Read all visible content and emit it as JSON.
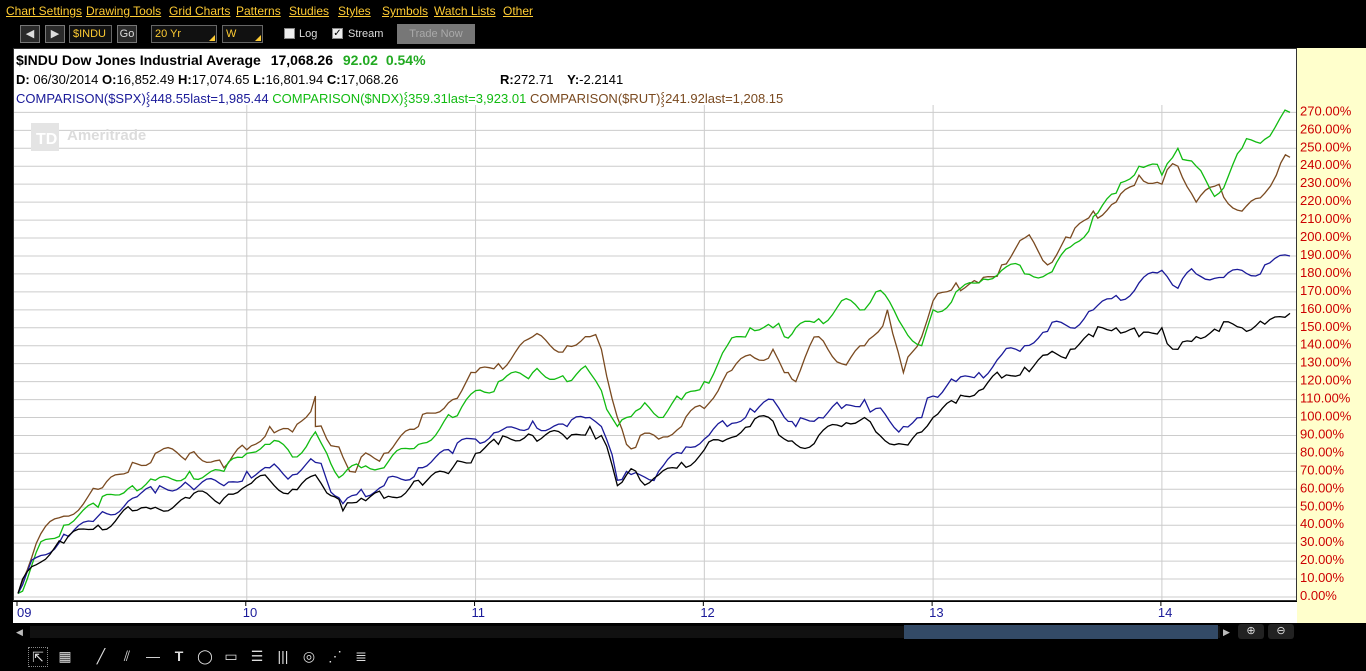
{
  "menu": [
    "Chart Settings",
    "Drawing Tools",
    "Grid Charts",
    "Patterns",
    "Studies",
    "Styles",
    "Symbols",
    "Watch Lists",
    "Other"
  ],
  "toolbar": {
    "symbol": "$INDU",
    "go_label": "Go",
    "period": "20 Yr",
    "interval": "W",
    "log_label": "Log",
    "log_checked": false,
    "stream_label": "Stream",
    "stream_checked": true,
    "check_mark": "✓",
    "trade_label": "Trade Now"
  },
  "header": {
    "symbol_desc": "$INDU Dow Jones Industrial Average",
    "last": "17,068.26",
    "change": "92.02",
    "change_pct": "0.54%",
    "d_label": "D:",
    "date": "06/30/2014",
    "o_label": "O:",
    "open": "16,852.49",
    "h_label": "H:",
    "high": "17,074.65",
    "l_label": "L:",
    "low": "16,801.94",
    "c_label": "C:",
    "close": "17,068.26",
    "r_label": "R:",
    "range": "272.71",
    "y_label": "Y:",
    "y_value": "-2.2141",
    "comparisons": [
      {
        "text": "COMPARISON($SPX)",
        "stats": "448.55last=1,985.44",
        "color": "#1a1a99"
      },
      {
        "text": "COMPARISON($NDX)",
        "stats": "359.31last=3,923.01",
        "color": "#11bb11"
      },
      {
        "text": "COMPARISON($RUT)",
        "stats": "241.92last=1,208.15",
        "color": "#7a4a20"
      }
    ]
  },
  "watermark": "Ameritrade",
  "watermark_logo": "TD",
  "colors": {
    "yaxis_text": "#cc0000",
    "xaxis_text": "#1a1a99",
    "grid": "#cccccc",
    "indu": "#000000",
    "spx": "#1a1a99",
    "ndx": "#11bb11",
    "rut": "#7a4a20"
  },
  "chart_data": {
    "type": "line",
    "title": "",
    "x_labels": [
      "09",
      "10",
      "11",
      "12",
      "13",
      "14"
    ],
    "y_ticks": [
      "0.00%",
      "10.00%",
      "20.00%",
      "30.00%",
      "40.00%",
      "50.00%",
      "60.00%",
      "70.00%",
      "80.00%",
      "90.00%",
      "100.00%",
      "110.00%",
      "120.00%",
      "130.00%",
      "140.00%",
      "150.00%",
      "160.00%",
      "170.00%",
      "180.00%",
      "190.00%",
      "200.00%",
      "210.00%",
      "220.00%",
      "230.00%",
      "240.00%",
      "250.00%",
      "260.00%",
      "270.00%"
    ],
    "ylim": [
      0,
      273
    ],
    "xlim": [
      2009.0,
      2014.56
    ],
    "grid": true,
    "series": [
      {
        "key": "rut",
        "x": [
          2009.0,
          2009.08,
          2009.2,
          2009.35,
          2009.5,
          2009.6,
          2009.75,
          2009.9,
          2010.0,
          2010.1,
          2010.2,
          2010.3,
          2010.3,
          2010.35,
          2010.42,
          2010.45,
          2010.5,
          2010.6,
          2010.75,
          2010.9,
          2011.0,
          2011.1,
          2011.25,
          2011.4,
          2011.5,
          2011.55,
          2011.62,
          2011.66,
          2011.72,
          2011.8,
          2011.9,
          2012.0,
          2012.1,
          2012.2,
          2012.3,
          2012.35,
          2012.4,
          2012.5,
          2012.6,
          2012.7,
          2012.8,
          2012.87,
          2012.95,
          2013.0,
          2013.1,
          2013.2,
          2013.3,
          2013.4,
          2013.5,
          2013.6,
          2013.7,
          2013.8,
          2013.9,
          2014.0,
          2014.07,
          2014.15,
          2014.25,
          2014.35,
          2014.45,
          2014.5,
          2014.56
        ],
        "y": [
          2,
          30,
          45,
          60,
          75,
          80,
          80,
          72,
          82,
          95,
          92,
          112,
          95,
          88,
          78,
          70,
          78,
          80,
          95,
          110,
          125,
          130,
          145,
          140,
          145,
          138,
          100,
          85,
          90,
          88,
          95,
          105,
          125,
          135,
          138,
          125,
          120,
          145,
          130,
          140,
          160,
          125,
          145,
          165,
          175,
          175,
          185,
          200,
          185,
          200,
          215,
          220,
          235,
          230,
          240,
          220,
          230,
          215,
          225,
          235,
          245
        ]
      },
      {
        "key": "ndx",
        "x": [
          2009.0,
          2009.08,
          2009.2,
          2009.35,
          2009.5,
          2009.6,
          2009.75,
          2009.9,
          2010.0,
          2010.1,
          2010.2,
          2010.3,
          2010.35,
          2010.42,
          2010.5,
          2010.6,
          2010.75,
          2010.9,
          2011.0,
          2011.1,
          2011.25,
          2011.4,
          2011.5,
          2011.55,
          2011.62,
          2011.66,
          2011.72,
          2011.8,
          2011.9,
          2012.0,
          2012.1,
          2012.2,
          2012.3,
          2012.35,
          2012.4,
          2012.5,
          2012.6,
          2012.7,
          2012.75,
          2012.87,
          2012.95,
          2013.0,
          2013.1,
          2013.2,
          2013.3,
          2013.4,
          2013.5,
          2013.6,
          2013.7,
          2013.8,
          2013.9,
          2014.0,
          2014.07,
          2014.15,
          2014.25,
          2014.35,
          2014.45,
          2014.56
        ],
        "y": [
          2,
          25,
          40,
          50,
          62,
          65,
          70,
          70,
          80,
          85,
          78,
          92,
          80,
          68,
          72,
          72,
          85,
          100,
          115,
          120,
          125,
          120,
          125,
          115,
          95,
          100,
          105,
          100,
          110,
          120,
          140,
          150,
          150,
          145,
          150,
          155,
          165,
          160,
          170,
          150,
          140,
          160,
          170,
          175,
          182,
          180,
          180,
          195,
          212,
          225,
          240,
          235,
          250,
          240,
          225,
          250,
          255,
          270
        ]
      },
      {
        "key": "spx",
        "x": [
          2009.0,
          2009.08,
          2009.2,
          2009.35,
          2009.5,
          2009.6,
          2009.75,
          2009.9,
          2010.0,
          2010.1,
          2010.2,
          2010.3,
          2010.35,
          2010.42,
          2010.5,
          2010.6,
          2010.75,
          2010.9,
          2011.0,
          2011.1,
          2011.25,
          2011.4,
          2011.5,
          2011.55,
          2011.62,
          2011.66,
          2011.72,
          2011.8,
          2011.9,
          2012.0,
          2012.1,
          2012.2,
          2012.3,
          2012.35,
          2012.4,
          2012.5,
          2012.6,
          2012.7,
          2012.75,
          2012.87,
          2012.95,
          2013.0,
          2013.1,
          2013.2,
          2013.3,
          2013.4,
          2013.5,
          2013.6,
          2013.7,
          2013.8,
          2013.9,
          2014.0,
          2014.07,
          2014.15,
          2014.25,
          2014.35,
          2014.45,
          2014.56
        ],
        "y": [
          2,
          22,
          35,
          45,
          55,
          58,
          62,
          62,
          70,
          72,
          68,
          75,
          65,
          52,
          60,
          62,
          72,
          80,
          88,
          92,
          98,
          95,
          100,
          95,
          65,
          70,
          68,
          70,
          80,
          88,
          95,
          105,
          110,
          100,
          95,
          100,
          105,
          110,
          105,
          95,
          100,
          112,
          120,
          125,
          135,
          140,
          148,
          150,
          160,
          168,
          175,
          182,
          172,
          180,
          178,
          182,
          185,
          190
        ]
      },
      {
        "key": "indu",
        "x": [
          2009.0,
          2009.08,
          2009.2,
          2009.35,
          2009.5,
          2009.6,
          2009.75,
          2009.9,
          2010.0,
          2010.1,
          2010.2,
          2010.3,
          2010.35,
          2010.42,
          2010.5,
          2010.6,
          2010.75,
          2010.9,
          2011.0,
          2011.1,
          2011.25,
          2011.4,
          2011.5,
          2011.55,
          2011.62,
          2011.66,
          2011.72,
          2011.8,
          2011.9,
          2012.0,
          2012.1,
          2012.2,
          2012.3,
          2012.35,
          2012.4,
          2012.5,
          2012.6,
          2012.7,
          2012.75,
          2012.87,
          2012.95,
          2013.0,
          2013.1,
          2013.2,
          2013.3,
          2013.4,
          2013.5,
          2013.6,
          2013.7,
          2013.8,
          2013.9,
          2014.0,
          2014.07,
          2014.15,
          2014.25,
          2014.35,
          2014.45,
          2014.56
        ],
        "y": [
          2,
          18,
          30,
          40,
          48,
          50,
          55,
          55,
          62,
          65,
          60,
          68,
          58,
          48,
          55,
          55,
          65,
          72,
          80,
          85,
          90,
          88,
          95,
          90,
          62,
          68,
          65,
          68,
          75,
          82,
          88,
          95,
          98,
          88,
          85,
          90,
          95,
          100,
          92,
          85,
          92,
          100,
          108,
          115,
          122,
          128,
          135,
          138,
          145,
          150,
          145,
          150,
          138,
          145,
          148,
          150,
          152,
          158
        ]
      }
    ]
  }
}
